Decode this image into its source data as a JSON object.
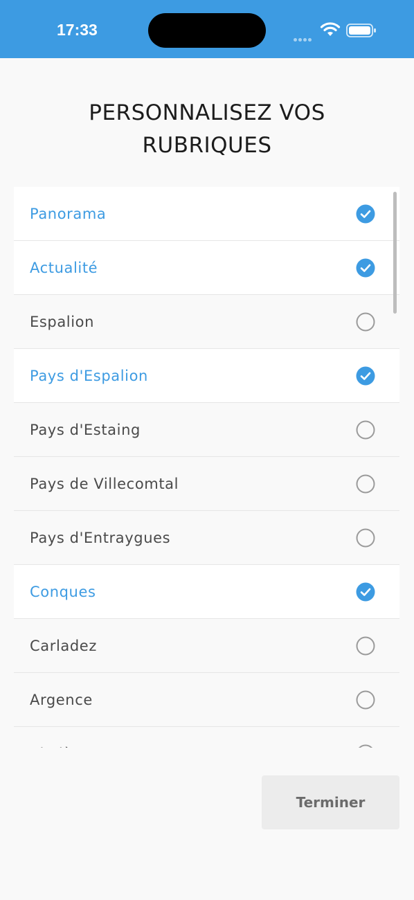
{
  "status_bar": {
    "time": "17:33",
    "icons": [
      "signal-icon",
      "wifi-icon",
      "battery-icon"
    ],
    "background": "#3d9be2"
  },
  "page": {
    "title_line1": "PERSONNALISEZ VOS",
    "title_line2": "RUBRIQUES"
  },
  "colors": {
    "accent": "#3d9be2",
    "unselected_text": "#4a4a4a"
  },
  "rubriques": [
    {
      "label": "Panorama",
      "selected": true
    },
    {
      "label": "Actualité",
      "selected": true
    },
    {
      "label": "Espalion",
      "selected": false
    },
    {
      "label": "Pays d'Espalion",
      "selected": true
    },
    {
      "label": "Pays d'Estaing",
      "selected": false
    },
    {
      "label": "Pays de Villecomtal",
      "selected": false
    },
    {
      "label": "Pays d'Entraygues",
      "selected": false
    },
    {
      "label": "Conques",
      "selected": true
    },
    {
      "label": "Carladez",
      "selected": false
    },
    {
      "label": "Argence",
      "selected": false
    },
    {
      "label": "Viadène",
      "selected": false
    }
  ],
  "footer": {
    "finish_label": "Terminer"
  }
}
